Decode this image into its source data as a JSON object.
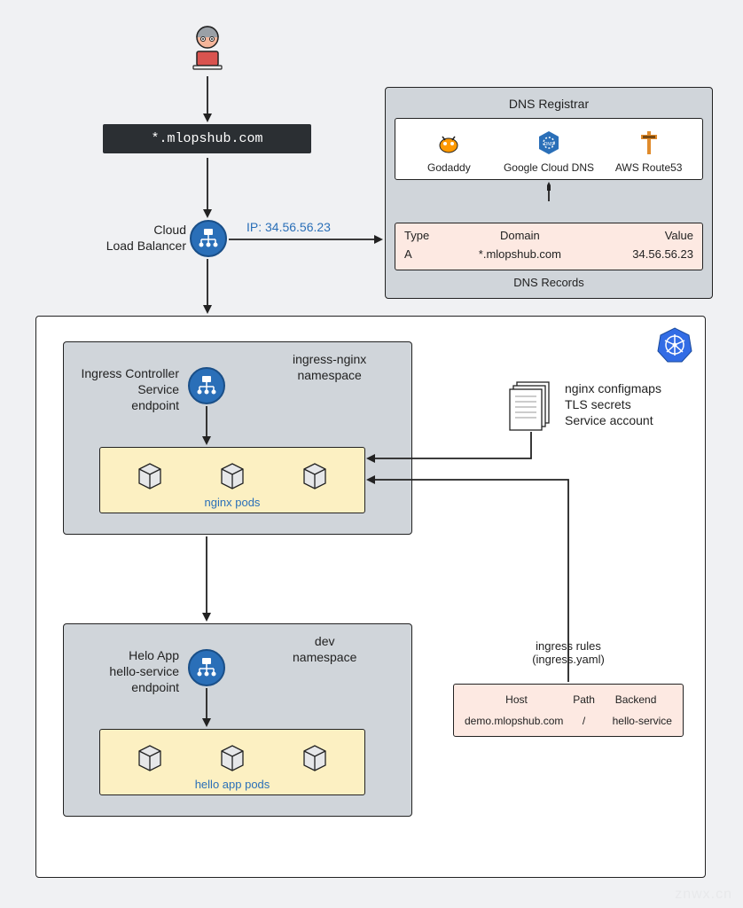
{
  "domain_bar": "*.mlopshub.com",
  "load_balancer_label": "Cloud\nLoad Balancer",
  "ip_label": "IP: 34.56.56.23",
  "registrar": {
    "title": "DNS Registrar",
    "providers": [
      "Godaddy",
      "Google Cloud DNS",
      "AWS Route53"
    ],
    "records_label": "DNS Records",
    "table": {
      "headers": [
        "Type",
        "Domain",
        "Value"
      ],
      "row": [
        "A",
        "*.mlopshub.com",
        "34.56.56.23"
      ]
    }
  },
  "cluster": {
    "ingress_ns": {
      "label": "ingress-nginx\nnamespace",
      "svc_label": "Ingress Controller\nService\nendpoint",
      "pods_label": "nginx pods"
    },
    "dev_ns": {
      "label": "dev\nnamespace",
      "svc_label": "Helo App\nhello-service\nendpoint",
      "pods_label": "hello app pods"
    },
    "configs_label": "nginx configmaps\nTLS secrets\nService account",
    "ingress_rules": {
      "label": "ingress rules\n(ingress.yaml)",
      "headers": [
        "Host",
        "Path",
        "Backend"
      ],
      "row": [
        "demo.mlopshub.com",
        "/",
        "hello-service"
      ]
    }
  },
  "watermark": "znwx.cn"
}
